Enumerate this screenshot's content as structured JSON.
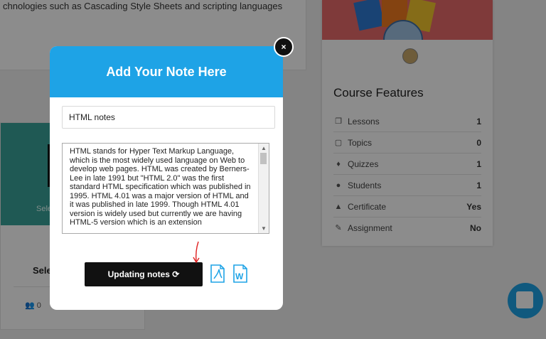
{
  "background": {
    "top_text": "chnologies such as Cascading Style Sheets and scripting languages",
    "course_card": {
      "thumb_label": "Sele",
      "title": "Sele",
      "students": "0"
    },
    "course_features": {
      "title": "Course Features",
      "items": [
        {
          "icon": "lessons-icon",
          "label": "Lessons",
          "value": "1"
        },
        {
          "icon": "topics-icon",
          "label": "Topics",
          "value": "0"
        },
        {
          "icon": "quizzes-icon",
          "label": "Quizzes",
          "value": "1"
        },
        {
          "icon": "students-icon",
          "label": "Students",
          "value": "1"
        },
        {
          "icon": "certificate-icon",
          "label": "Certificate",
          "value": "Yes"
        },
        {
          "icon": "assignment-icon",
          "label": "Assignment",
          "value": "No"
        }
      ]
    }
  },
  "modal": {
    "title": "Add Your Note Here",
    "title_input_value": "HTML notes",
    "note_text": "HTML stands for Hyper Text Markup Language, which is the most widely used language on Web to develop web pages. HTML was created by Berners-Lee in late 1991 but \"HTML 2.0\" was the first standard HTML specification which was published in 1995. HTML 4.01 was a major version of HTML and it was published in late 1999. Though HTML 4.01 version is widely used but currently we are having HTML-5 version which is an extension",
    "update_button_label": "Updating notes",
    "close_label": "×"
  },
  "colors": {
    "accent": "#1ea3e6",
    "pdf_icon": "#1ea3e6",
    "word_icon": "#1ea3e6",
    "annotation_arrow": "#e02020"
  }
}
